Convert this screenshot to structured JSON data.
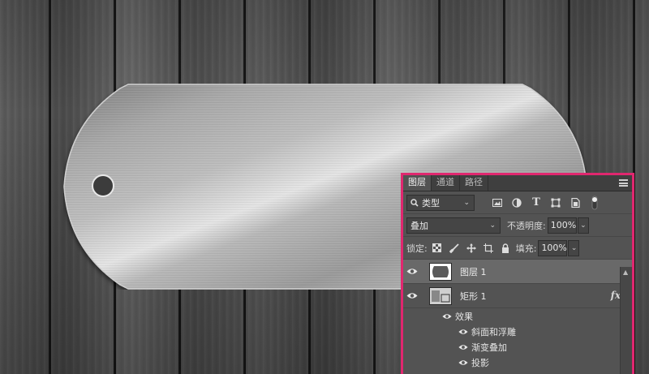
{
  "tabs": [
    {
      "label": "图层",
      "active": true
    },
    {
      "label": "通道",
      "active": false
    },
    {
      "label": "路径",
      "active": false
    }
  ],
  "filter": {
    "kind_label": "类型"
  },
  "blend": {
    "mode": "叠加",
    "opacity_label": "不透明度:",
    "opacity_value": "100%"
  },
  "lock": {
    "label": "锁定:",
    "fill_label": "填充:",
    "fill_value": "100%"
  },
  "layers": [
    {
      "name": "图层 1",
      "selected": true
    },
    {
      "name": "矩形 1",
      "selected": false,
      "fx": "fx"
    }
  ],
  "effects": {
    "header": "效果",
    "items": [
      "斜面和浮雕",
      "渐变叠加",
      "投影"
    ]
  },
  "colors": {
    "panel_border": "#e0276f",
    "panel_bg": "#535353"
  }
}
